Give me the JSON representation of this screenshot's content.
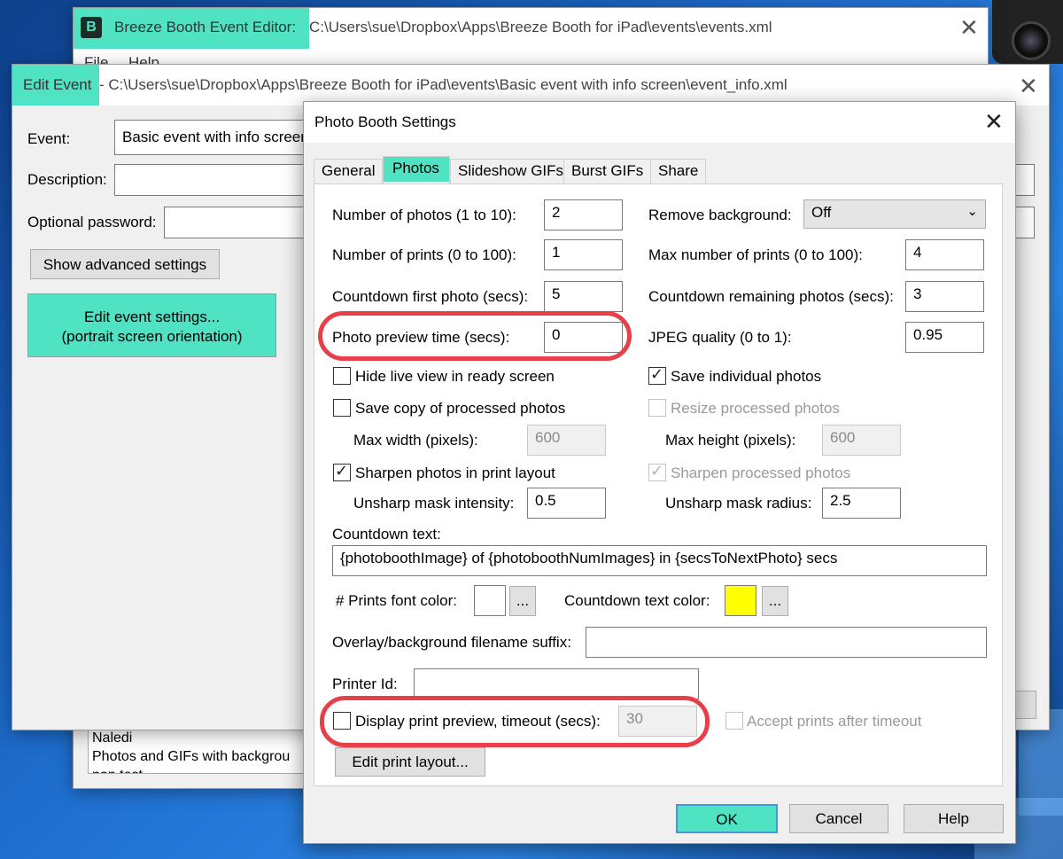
{
  "editor_window": {
    "title_app": "Breeze Booth Event Editor:",
    "title_path": " C:\\Users\\sue\\Dropbox\\Apps\\Breeze Booth for iPad\\events\\events.xml",
    "menu": [
      "File",
      "Help"
    ],
    "list_items": [
      "Naledi",
      "Photos and GIFs with backgrou",
      "non test"
    ]
  },
  "edit_event": {
    "title_app": "Edit Event",
    "title_path": " - C:\\Users\\sue\\Dropbox\\Apps\\Breeze Booth for iPad\\events\\Basic event with info screen\\event_info.xml",
    "event_label": "Event:",
    "event_value": "Basic event with info screen",
    "description_label": "Description:",
    "password_label": "Optional password:",
    "advanced_button": "Show advanced settings",
    "edit_settings_line1": "Edit event settings...",
    "edit_settings_line2": "(portrait screen orientation)"
  },
  "dialog": {
    "title": "Photo Booth Settings",
    "tabs": [
      "General",
      "Photos",
      "Slideshow GIFs",
      "Burst GIFs",
      "Share"
    ],
    "selected_tab": "Photos",
    "num_photos_label": "Number of photos (1 to 10):",
    "num_photos": "2",
    "num_prints_label": "Number of prints (0 to 100):",
    "num_prints": "1",
    "countdown_first_label": "Countdown first photo (secs):",
    "countdown_first": "5",
    "preview_time_label": "Photo preview time (secs):",
    "preview_time": "0",
    "remove_bg_label": "Remove background:",
    "remove_bg": "Off",
    "max_prints_label": "Max number of prints (0 to 100):",
    "max_prints": "4",
    "countdown_remaining_label": "Countdown remaining photos (secs):",
    "countdown_remaining": "3",
    "jpeg_label": "JPEG quality (0 to 1):",
    "jpeg": "0.95",
    "hide_live_label": "Hide live view in ready screen",
    "hide_live_checked": false,
    "save_individual_label": "Save individual photos",
    "save_individual_checked": true,
    "save_copy_label": "Save copy of processed photos",
    "save_copy_checked": false,
    "resize_label": "Resize processed photos",
    "resize_checked": false,
    "max_width_label": "Max width (pixels):",
    "max_width": "600",
    "max_height_label": "Max height (pixels):",
    "max_height": "600",
    "sharpen_print_label": "Sharpen photos in print layout",
    "sharpen_print_checked": true,
    "sharpen_processed_label": "Sharpen processed photos",
    "sharpen_processed_checked": true,
    "unsharp_intensity_label": "Unsharp mask intensity:",
    "unsharp_intensity": "0.5",
    "unsharp_radius_label": "Unsharp mask radius:",
    "unsharp_radius": "2.5",
    "countdown_text_label": "Countdown text:",
    "countdown_text": "{photoboothImage} of {photoboothNumImages} in {secsToNextPhoto} secs",
    "prints_font_color_label": "# Prints font color:",
    "prints_font_color": "#ffffff",
    "countdown_color_label": "Countdown text color:",
    "countdown_color": "#ffff00",
    "ellipsis": "...",
    "overlay_suffix_label": "Overlay/background filename suffix:",
    "overlay_suffix": "",
    "printer_id_label": "Printer Id:",
    "printer_id": "",
    "display_preview_label": "Display print preview, timeout (secs):",
    "display_preview_checked": false,
    "preview_timeout": "30",
    "accept_prints_label": "Accept prints after timeout",
    "accept_prints_checked": false,
    "edit_print_layout": "Edit print layout...",
    "ok": "OK",
    "cancel": "Cancel",
    "help": "Help"
  },
  "colors": {
    "highlight": "#4fe3c4",
    "annotation_ring": "#e8404a"
  }
}
